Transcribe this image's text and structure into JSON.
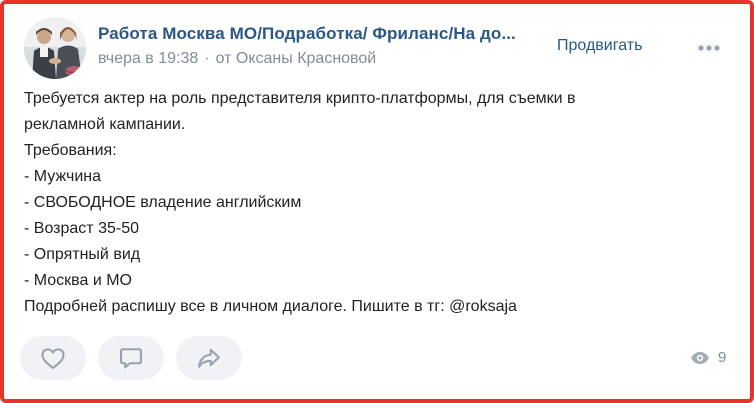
{
  "post": {
    "group_title": "Работа Москва МО/Подработка/ Фриланс/На до...",
    "time": "вчера в 19:38",
    "separator": "·",
    "author": "от Оксаны Красновой",
    "promote_label": "Продвигать",
    "more_icon": "more-dots-icon",
    "lines": [
      "Требуется актер на роль представителя крипто-платформы, для съемки в",
      "рекламной кампании.",
      "Требования:",
      "- Мужчина",
      "- СВОБОДНОЕ владение английским",
      "- Возраст 35-50",
      "- Опрятный вид",
      "- Москва и МО",
      "Подробней распишу все в личном диалоге. Пишите в тг: @roksaja"
    ]
  },
  "actions": {
    "like_icon": "heart-icon",
    "comment_icon": "comment-icon",
    "share_icon": "share-icon"
  },
  "views": {
    "icon": "eye-icon",
    "count": "9"
  },
  "colors": {
    "link": "#2a5885",
    "meta": "#818c99",
    "text": "#222222",
    "button_bg": "#f0f2f5",
    "frame_border": "#e8332a"
  }
}
